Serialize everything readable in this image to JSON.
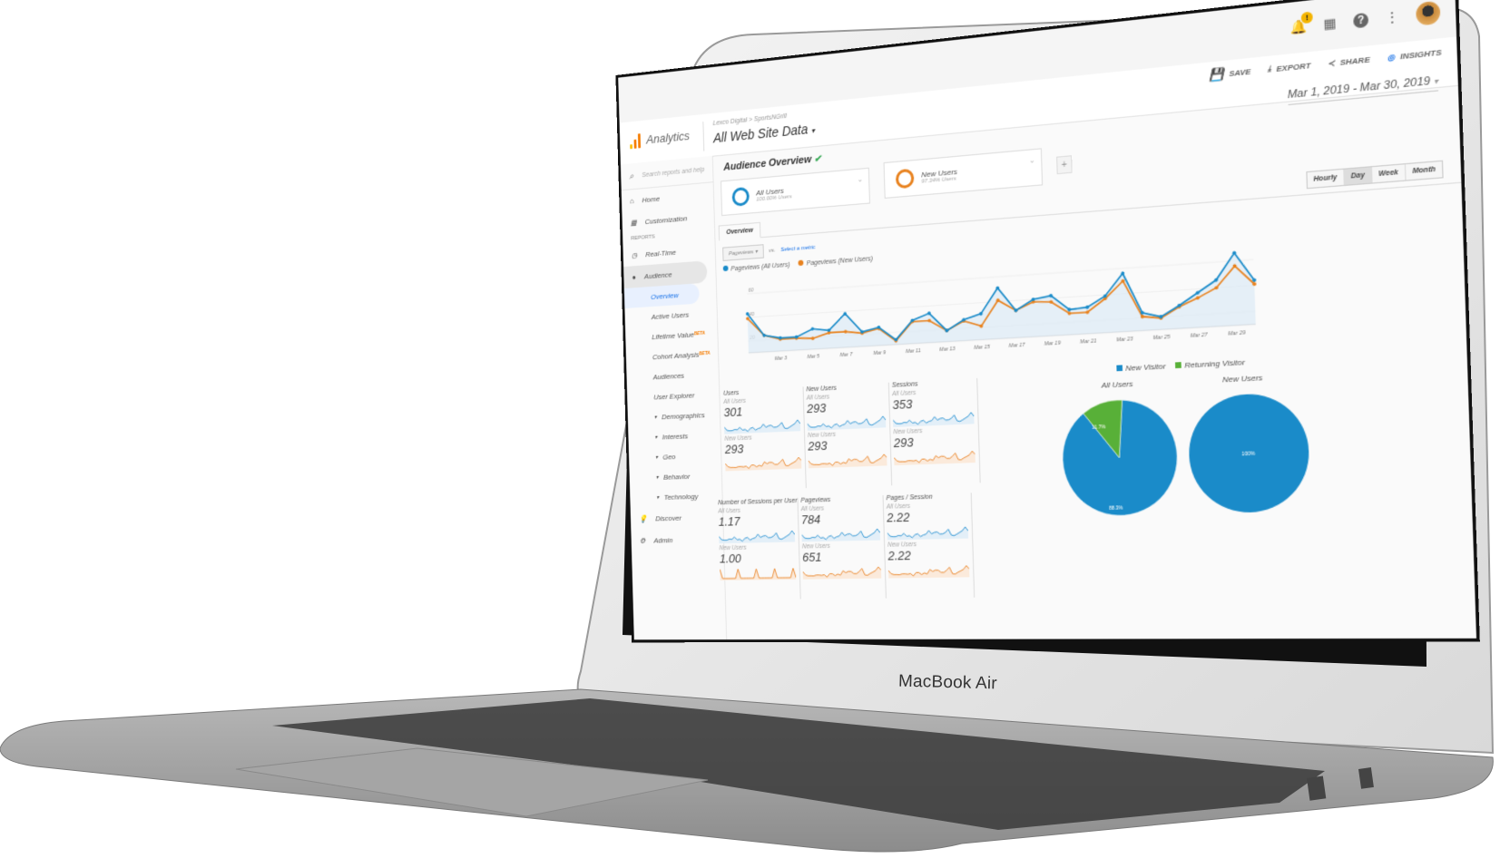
{
  "device": {
    "label": "MacBook Air"
  },
  "topbar": {
    "notification_badge": "!",
    "icons": [
      "bell-icon",
      "apps-grid-icon",
      "help-icon",
      "more-vert-icon",
      "avatar"
    ]
  },
  "header": {
    "brand": "Analytics",
    "breadcrumb": "Lexco Digital > SportsNGrill",
    "property": "All Web Site Data",
    "actions": [
      {
        "label": "SAVE",
        "icon": "save-icon"
      },
      {
        "label": "EXPORT",
        "icon": "export-icon"
      },
      {
        "label": "SHARE",
        "icon": "share-icon"
      },
      {
        "label": "INSIGHTS",
        "icon": "insights-icon"
      }
    ],
    "date_range": "Mar 1, 2019 - Mar 30, 2019"
  },
  "sidebar": {
    "search_placeholder": "Search reports and help",
    "home": "Home",
    "customization": "Customization",
    "section_reports": "REPORTS",
    "realtime": "Real-Time",
    "audience": "Audience",
    "audience_items": [
      {
        "label": "Overview",
        "active": true
      },
      {
        "label": "Active Users"
      },
      {
        "label": "Lifetime Value",
        "badge": "BETA"
      },
      {
        "label": "Cohort Analysis",
        "badge": "BETA"
      },
      {
        "label": "Audiences"
      },
      {
        "label": "User Explorer"
      }
    ],
    "collapsible": [
      "Demographics",
      "Interests",
      "Geo",
      "Behavior",
      "Technology"
    ],
    "discover": "Discover",
    "admin": "Admin"
  },
  "main": {
    "title": "Audience Overview",
    "segments": [
      {
        "name": "All Users",
        "sub": "100.00% Users",
        "color": "#1a8bc9"
      },
      {
        "name": "New Users",
        "sub": "97.34% Users",
        "color": "#e8821e"
      }
    ],
    "add_segment": "+",
    "tab": "Overview",
    "granularity": [
      "Hourly",
      "Day",
      "Week",
      "Month"
    ],
    "granularity_selected": "Day",
    "metric_select": "Pageviews",
    "vs": "vs.",
    "select_metric": "Select a metric",
    "legend": [
      "Pageviews (All Users)",
      "Pageviews (New Users)"
    ]
  },
  "chart_data": [
    {
      "type": "line",
      "title": "Pageviews",
      "x": [
        "Mar 1",
        "Mar 2",
        "Mar 3",
        "Mar 4",
        "Mar 5",
        "Mar 6",
        "Mar 7",
        "Mar 8",
        "Mar 9",
        "Mar 10",
        "Mar 11",
        "Mar 12",
        "Mar 13",
        "Mar 14",
        "Mar 15",
        "Mar 16",
        "Mar 17",
        "Mar 18",
        "Mar 19",
        "Mar 20",
        "Mar 21",
        "Mar 22",
        "Mar 23",
        "Mar 24",
        "Mar 25",
        "Mar 26",
        "Mar 27",
        "Mar 28",
        "Mar 29",
        "Mar 30"
      ],
      "xticks": [
        "Mar 3",
        "Mar 5",
        "Mar 7",
        "Mar 9",
        "Mar 11",
        "Mar 13",
        "Mar 15",
        "Mar 17",
        "Mar 19",
        "Mar 21",
        "Mar 23",
        "Mar 25",
        "Mar 27",
        "Mar 29"
      ],
      "yticks": [
        20,
        40,
        60
      ],
      "ylim": [
        10,
        70
      ],
      "series": [
        {
          "name": "Pageviews (All Users)",
          "color": "#1a8bc9",
          "values": [
            43,
            24,
            21,
            21,
            27,
            25,
            38,
            22,
            25,
            14,
            29,
            34,
            19,
            27,
            31,
            51,
            32,
            40,
            42,
            30,
            31,
            39,
            56,
            24,
            20,
            28,
            37,
            46,
            66,
            44
          ]
        },
        {
          "name": "Pageviews (New Users)",
          "color": "#e8821e",
          "values": [
            39,
            24,
            20,
            20,
            19,
            23,
            23,
            21,
            24,
            13,
            28,
            28,
            19,
            26,
            21,
            41,
            32,
            38,
            37,
            27,
            27,
            37,
            50,
            21,
            19,
            27,
            33,
            40,
            56,
            41
          ]
        }
      ]
    },
    {
      "type": "pie",
      "title": "All Users",
      "labels": [
        "New Visitor",
        "Returning Visitor"
      ],
      "values": [
        88.3,
        11.7
      ],
      "colors": [
        "#1a8bc9",
        "#58b038"
      ]
    },
    {
      "type": "pie",
      "title": "New Users",
      "labels": [
        "New Visitor"
      ],
      "values": [
        100
      ],
      "colors": [
        "#1a8bc9"
      ]
    }
  ],
  "pie_labels": {
    "all_users_new": "88.3%",
    "all_users_ret": "11.7%",
    "new_users_new": "100%"
  },
  "metrics": [
    {
      "label": "Users",
      "all_users": "301",
      "new_users": "293"
    },
    {
      "label": "New Users",
      "all_users": "293",
      "new_users": "293"
    },
    {
      "label": "Sessions",
      "all_users": "353",
      "new_users": "293"
    },
    {
      "label": "Number of Sessions per User",
      "all_users": "1.17",
      "new_users": "1.00"
    },
    {
      "label": "Pageviews",
      "all_users": "784",
      "new_users": "651"
    },
    {
      "label": "Pages / Session",
      "all_users": "2.22",
      "new_users": "2.22"
    }
  ],
  "segment_labels": {
    "all": "All Users",
    "new": "New Users"
  }
}
